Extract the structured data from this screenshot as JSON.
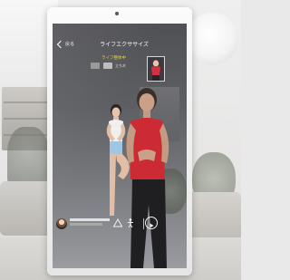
{
  "app": {
    "back_label": "戻る",
    "title": "ライフエクササイズ",
    "subtitle": "ライフ整体中",
    "pose_label": "立ち木"
  },
  "icons": {
    "back": "chevron-left-icon",
    "pose": "person-pose-icon",
    "play": "play-circle-icon"
  }
}
